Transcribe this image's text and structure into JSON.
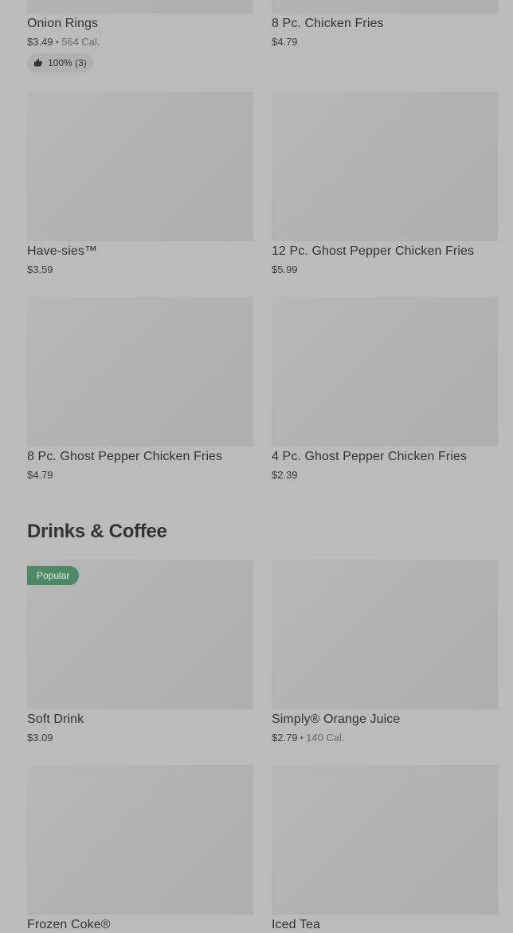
{
  "items": [
    {
      "name": "Onion Rings",
      "price": "$3.49",
      "calories": "564 Cal.",
      "rating": "100% (3)"
    },
    {
      "name": "8 Pc. Chicken Fries",
      "price": "$4.79"
    },
    {
      "name": "Have-sies™",
      "price": "$3.59"
    },
    {
      "name": "12 Pc. Ghost Pepper Chicken Fries",
      "price": "$5.99"
    },
    {
      "name": "8 Pc. Ghost Pepper Chicken Fries",
      "price": "$4.79"
    },
    {
      "name": "4 Pc. Ghost Pepper Chicken Fries",
      "price": "$2.39"
    }
  ],
  "drinks_section": {
    "title": "Drinks & Coffee",
    "items": [
      {
        "name": "Soft Drink",
        "price": "$3.09",
        "badge": "Popular"
      },
      {
        "name": "Simply® Orange Juice",
        "price": "$2.79",
        "calories": "140 Cal."
      },
      {
        "name": "Frozen Coke®"
      },
      {
        "name": "Iced Tea"
      }
    ]
  },
  "colors": {
    "background": "#bbbbbb",
    "image_placeholder": "#b2b2b2",
    "popular_badge": "#4e8866"
  },
  "icons": {
    "rating": "thumbs-up-icon"
  }
}
